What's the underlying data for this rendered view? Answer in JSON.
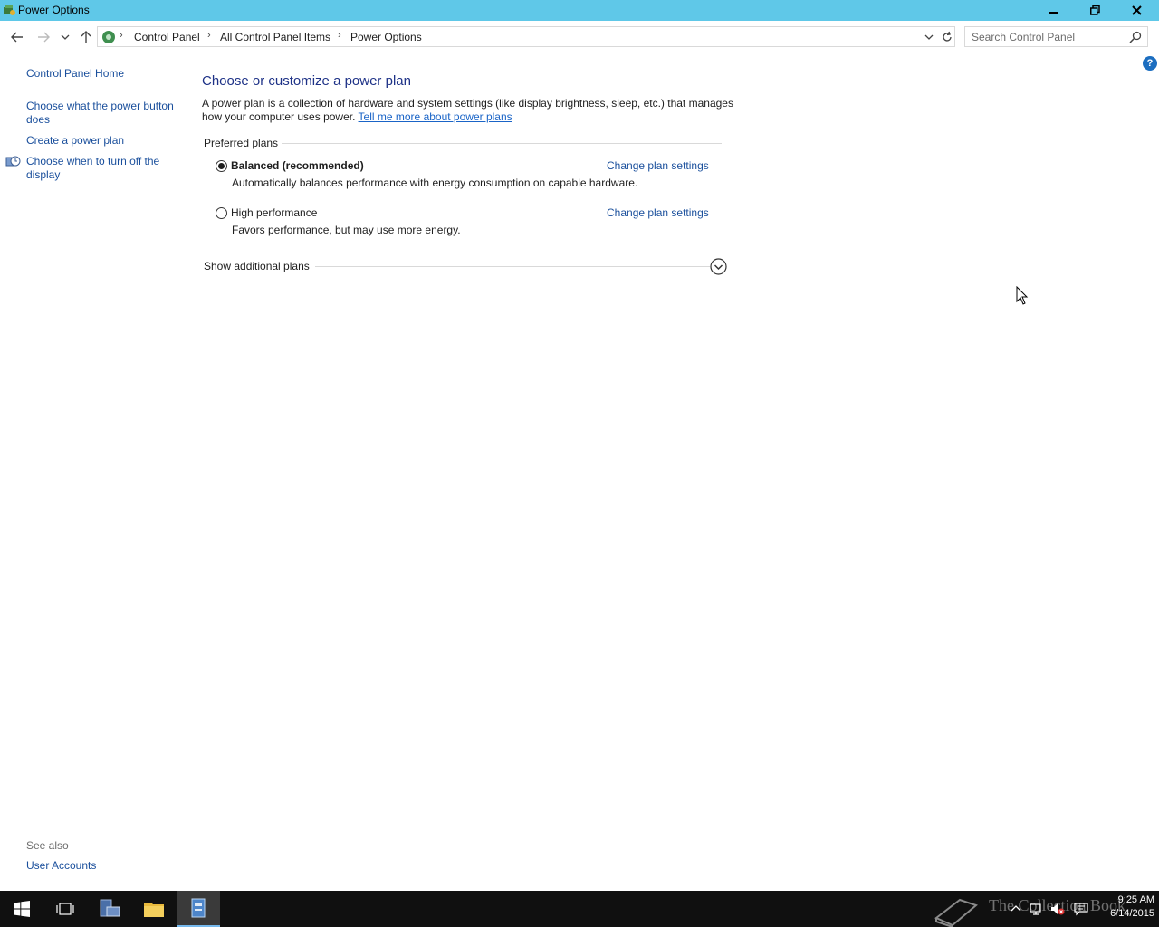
{
  "window": {
    "title": "Power Options",
    "icon": "power-options-icon"
  },
  "address": {
    "crumbs": [
      "Control Panel",
      "All Control Panel Items",
      "Power Options"
    ]
  },
  "search": {
    "placeholder": "Search Control Panel"
  },
  "left_pane": {
    "home": "Control Panel Home",
    "link_power_button": "Choose what the power button does",
    "link_create_plan": "Create a power plan",
    "link_display_off": "Choose when to turn off the display",
    "see_also_label": "See also",
    "user_accounts": "User Accounts"
  },
  "main": {
    "heading": "Choose or customize a power plan",
    "description": "A power plan is a collection of hardware and system settings (like display brightness, sleep, etc.) that manages how your computer uses power.",
    "description_link": "Tell me more about power plans",
    "group_label": "Preferred plans",
    "plans": [
      {
        "name": "Balanced (recommended)",
        "description": "Automatically balances performance with energy consumption on capable hardware.",
        "selected": true,
        "change_link": "Change plan settings"
      },
      {
        "name": "High performance",
        "description": "Favors performance, but may use more energy.",
        "selected": false,
        "change_link": "Change plan settings"
      }
    ],
    "show_additional": "Show additional plans"
  },
  "taskbar": {
    "time": "9:25 AM",
    "date": "6/14/2015",
    "watermark": "The Collection Book"
  },
  "colors": {
    "titlebar": "#5fc8e8",
    "link": "#1a4f9c",
    "heading": "#1e3287",
    "taskbar": "#101010"
  }
}
